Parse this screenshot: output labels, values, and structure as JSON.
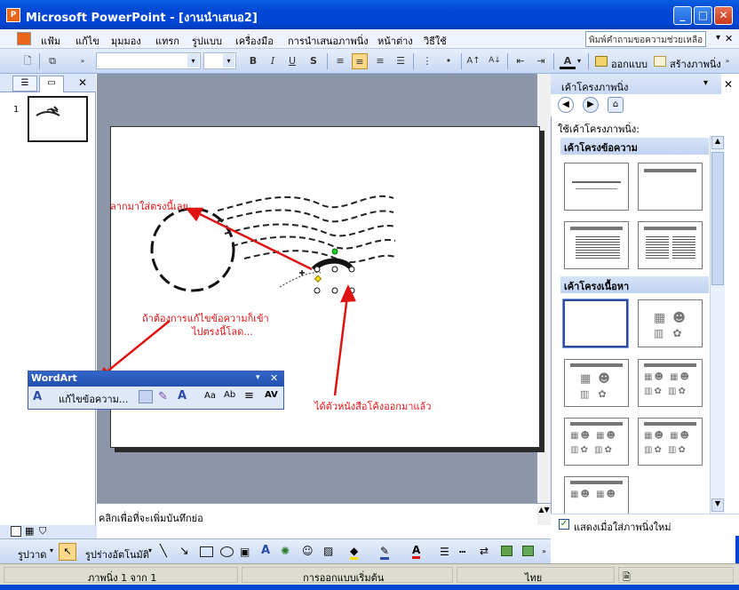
{
  "window": {
    "title": "Microsoft PowerPoint - [งานนำเสนอ2]",
    "app_icon": "powerpoint-icon"
  },
  "menu": {
    "items": [
      "แฟ้ม",
      "แก้ไข",
      "มุมมอง",
      "แทรก",
      "รูปแบบ",
      "เครื่องมือ",
      "การนำเสนอภาพนิ่ง",
      "หน้าต่าง",
      "วิธีใช้"
    ],
    "help_placeholder": "พิมพ์คำถามขอความช่วยเหลือ"
  },
  "format_toolbar": {
    "bold": "B",
    "italic": "I",
    "underline": "U",
    "shadow": "S",
    "design_label": "ออกแบบ",
    "new_slide_label": "สร้างภาพนิ่ง"
  },
  "slides_pane": {
    "slide_number": "1"
  },
  "annotations": {
    "drag_here": "ลากมาใส่ตรงนี้เลย",
    "edit_text_line1": "ถ้าต้องการแก้ไขข้อความก็เข้า",
    "edit_text_line2": "ไปตรงนี้โลด...",
    "curved_text": "ได้ตัวหนังสือโค้งออกมาแล้ว"
  },
  "wordart_toolbar": {
    "title": "WordArt",
    "edit_text_label": "แก้ไขข้อความ..."
  },
  "notes": {
    "placeholder": "คลิกเพื่อที่จะเพิ่มบันทึกย่อ"
  },
  "task_pane": {
    "title": "เค้าโครงภาพนิ่ง",
    "apply_label": "ใช้เค้าโครงภาพนิ่ง:",
    "text_layouts_header": "เค้าโครงข้อความ",
    "content_layouts_header": "เค้าโครงเนื้อหา",
    "show_on_insert_label": "แสดงเมื่อใส่ภาพนิ่งใหม่",
    "show_on_insert_checked": true
  },
  "draw_toolbar": {
    "draw_label": "รูปวาด",
    "autoshapes_label": "รูปร่างอัตโนมัติ"
  },
  "status_bar": {
    "slide_info": "ภาพนิ่ง 1 จาก 1",
    "design": "การออกแบบเริ่มต้น",
    "language": "ไทย"
  },
  "colors": {
    "title_bar": "#0046d4",
    "annotation": "#e01313",
    "canvas_bg": "#8d96a8"
  }
}
